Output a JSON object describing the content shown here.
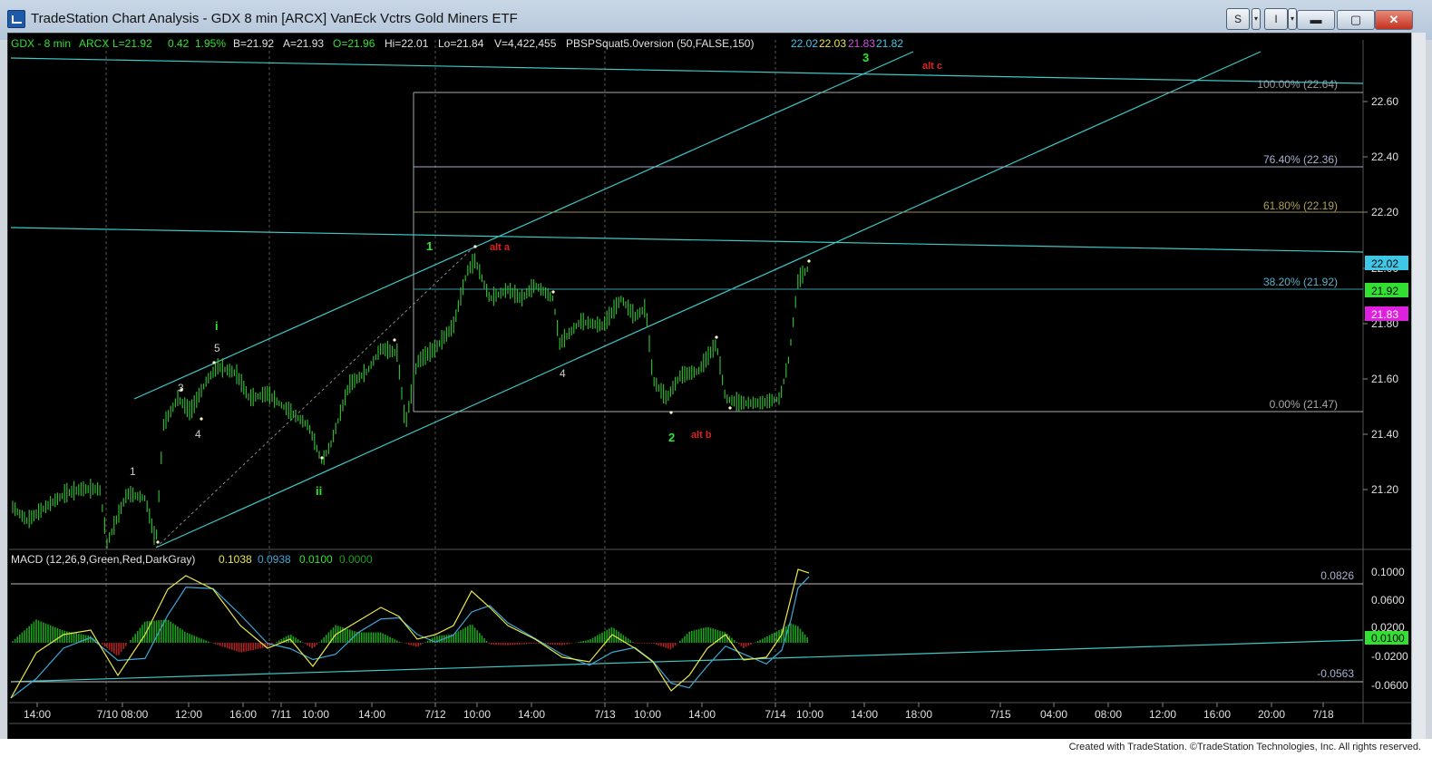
{
  "window": {
    "title": "TradeStation Chart Analysis - GDX 8 min [ARCX] VanEck Vctrs Gold Miners ETF",
    "btn_s": "S",
    "btn_i": "I",
    "min": "▬",
    "max": "▢",
    "close": "✕"
  },
  "header": {
    "symbol": "GDX - 8 min",
    "exchange": "ARCX",
    "last": "L=21.92",
    "change": "0.42",
    "pct": "1.95%",
    "bid": "B=21.92",
    "ask": "A=21.93",
    "open": "O=21.96",
    "hi": "Hi=22.01",
    "lo": "Lo=21.84",
    "vol": "V=4,422,455",
    "study": "PBSPSquat5.0version (50,FALSE,150)",
    "v1": "22.02",
    "v2": "22.03",
    "v3": "21.83",
    "v4": "21.82"
  },
  "colors": {
    "background": "#000000",
    "channel": "#3ec8c8",
    "bars": "#31b531",
    "wave_green": "#2ee82e",
    "wave_red": "#e02020",
    "macd": "#e8e84a",
    "signal": "#3fa7d8",
    "hist_pos": "#1aa01a",
    "hist_neg": "#b02020"
  },
  "price_axis": {
    "ticks": [
      "22.60",
      "22.40",
      "22.20",
      "22.00",
      "21.80",
      "21.60",
      "21.40",
      "21.20"
    ],
    "tag_2202": "22.02",
    "tag_2192": "21.92",
    "tag_2183": "21.83"
  },
  "fib": {
    "f100": "100.00% (22.64)",
    "f764": "76.40% (22.36)",
    "f618": "61.80% (22.19)",
    "f382": "38.20% (21.92)",
    "f0": "0.00% (21.47)"
  },
  "wave_labels": {
    "w3": "3",
    "alt_c": "alt c",
    "w1": "1",
    "alt_a": "alt a",
    "wi": "i",
    "w5": "5",
    "w3s": "3",
    "w4s": "4",
    "w1s": "1",
    "wii": "ii",
    "w4": "4",
    "w2": "2",
    "alt_b": "alt b"
  },
  "macd": {
    "label": "MACD (12,26,9,Green,Red,DarkGray)",
    "m1": "0.1038",
    "m2": "0.0938",
    "m3": "0.0100",
    "m4": "0.0000",
    "level_high": "0.0826",
    "level_low": "-0.0563",
    "ticks": [
      "0.1000",
      "0.0600",
      "0.0200",
      "-0.0200",
      "-0.0600"
    ],
    "tag": "0.0100"
  },
  "time_axis": [
    "14:00",
    "7/10 08:00",
    "12:00",
    "16:00",
    "7/11",
    "10:00",
    "14:00",
    "7/12",
    "10:00",
    "14:00",
    "7/13",
    "10:00",
    "14:00",
    "7/14",
    "10:00",
    "14:00",
    "18:00",
    "7/15",
    "04:00",
    "08:00",
    "12:00",
    "16:00",
    "20:00",
    "7/18"
  ],
  "footer": {
    "credit": "Created with TradeStation. ©TradeStation Technologies, Inc. All rights reserved."
  }
}
